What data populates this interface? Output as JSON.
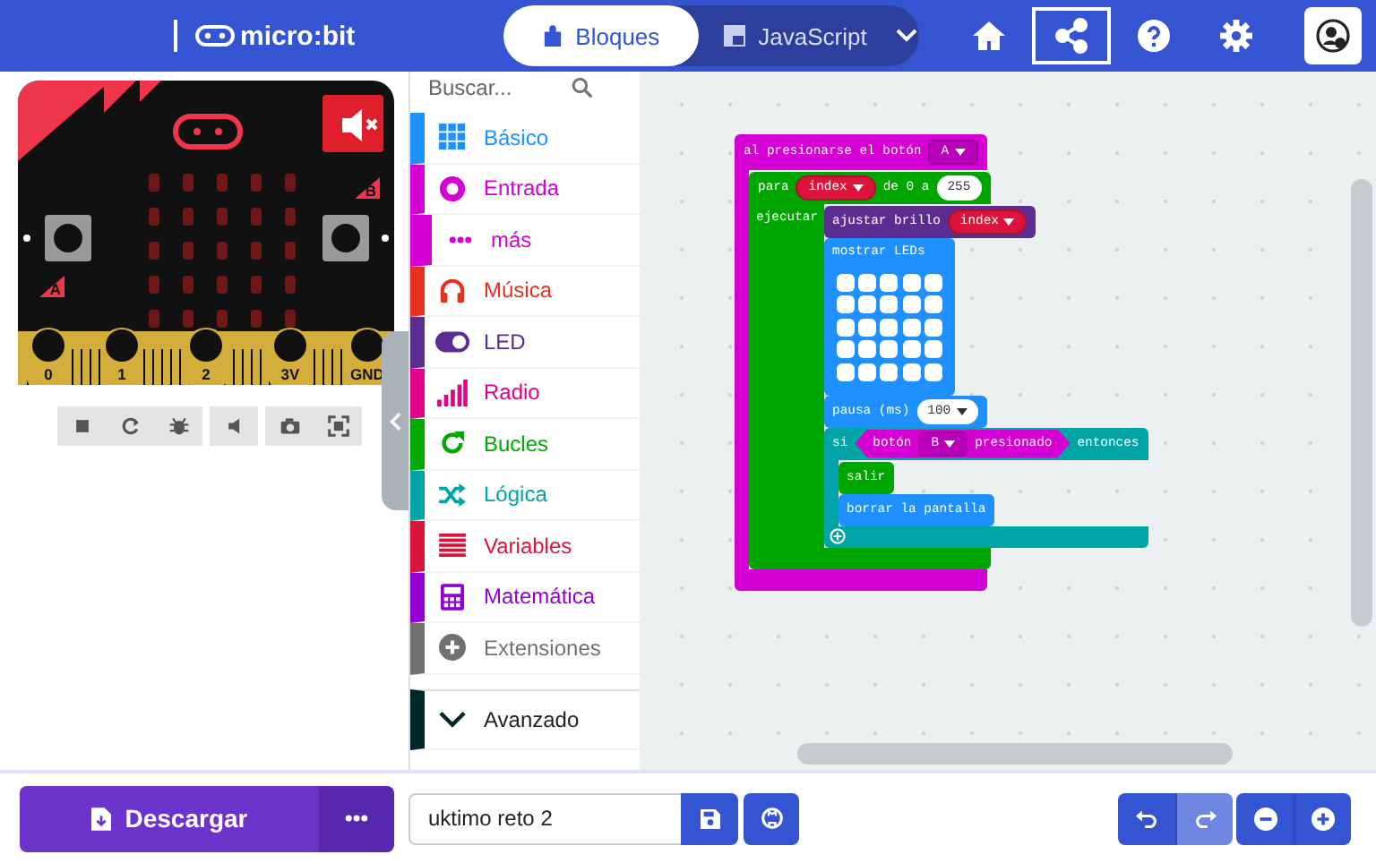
{
  "header": {
    "logo": "micro:bit",
    "tabs": [
      {
        "label": "Bloques",
        "selected": true
      },
      {
        "label": "JavaScript",
        "selected": false
      }
    ],
    "toolbar": [
      {
        "kind": "home",
        "selected": false
      },
      {
        "kind": "share",
        "selected": true
      },
      {
        "kind": "help",
        "selected": false
      },
      {
        "kind": "settings",
        "selected": false
      },
      {
        "kind": "account",
        "selected": false
      }
    ]
  },
  "simulator": {
    "muted": true,
    "buttons": [
      "A",
      "B"
    ],
    "pins": [
      "0",
      "1",
      "2",
      "3V",
      "GND"
    ],
    "controls": [
      {
        "kind": "stop"
      },
      {
        "kind": "restart"
      },
      {
        "kind": "debug"
      },
      {
        "kind": "mute"
      },
      {
        "kind": "screenshot"
      },
      {
        "kind": "fullscreen"
      }
    ]
  },
  "toolbox": {
    "placeholder": "Buscar...",
    "categories": [
      {
        "label": "Básico",
        "color": "#1e90ff",
        "kind": "category"
      },
      {
        "label": "Entrada",
        "color": "#d400d4",
        "kind": "category"
      },
      {
        "label": "más",
        "color": "#d400d4",
        "kind": "sub"
      },
      {
        "label": "Música",
        "color": "#e63022",
        "kind": "category"
      },
      {
        "label": "LED",
        "color": "#5c2d91",
        "kind": "category"
      },
      {
        "label": "Radio",
        "color": "#e3008c",
        "kind": "category"
      },
      {
        "label": "Bucles",
        "color": "#00aa00",
        "kind": "category"
      },
      {
        "label": "Lógica",
        "color": "#00a4a6",
        "kind": "category"
      },
      {
        "label": "Variables",
        "color": "#dc143c",
        "kind": "category"
      },
      {
        "label": "Matemática",
        "color": "#9400d3",
        "kind": "category"
      },
      {
        "label": "Extensiones",
        "color": "#717171",
        "kind": "category"
      },
      {
        "label": "Avanzado",
        "color": "#00272b",
        "kind": "advanced"
      }
    ]
  },
  "workspace": {
    "script": {
      "kind": "event",
      "color": "#d400d4",
      "parts": [
        {
          "kind": "text",
          "text": "al presionarse el botón"
        },
        {
          "kind": "dropdown",
          "text": "A"
        }
      ],
      "body": [
        {
          "kind": "loop",
          "color": "#00a500",
          "body_label": "ejecutar",
          "parts": [
            {
              "kind": "text",
              "text": "para"
            },
            {
              "kind": "variable",
              "text": "index"
            },
            {
              "kind": "text",
              "text": "de 0 a"
            },
            {
              "kind": "number",
              "text": "255"
            }
          ],
          "body": [
            {
              "kind": "statement",
              "color": "#5c2d91",
              "parts": [
                {
                  "kind": "text",
                  "text": "ajustar brillo"
                },
                {
                  "kind": "variable",
                  "text": "index"
                }
              ]
            },
            {
              "kind": "leds",
              "color": "#1e90ff",
              "parts": [
                {
                  "kind": "text",
                  "text": "mostrar LEDs"
                }
              ]
            },
            {
              "kind": "statement",
              "color": "#1e90ff",
              "parts": [
                {
                  "kind": "text",
                  "text": "pausa (ms)"
                },
                {
                  "kind": "number_dropdown",
                  "text": "100"
                }
              ]
            },
            {
              "kind": "if",
              "color": "#00a4a6",
              "parts": [
                {
                  "kind": "text",
                  "text": "si"
                },
                {
                  "kind": "boolean",
                  "color": "#d400d4",
                  "parts": [
                    {
                      "kind": "text",
                      "text": "botón"
                    },
                    {
                      "kind": "dropdown",
                      "text": "B"
                    },
                    {
                      "kind": "text",
                      "text": "presionado"
                    }
                  ]
                },
                {
                  "kind": "text",
                  "text": "entonces"
                }
              ],
              "body": [
                {
                  "kind": "statement",
                  "color": "#00a500",
                  "parts": [
                    {
                      "kind": "text",
                      "text": "salir"
                    }
                  ]
                },
                {
                  "kind": "statement",
                  "color": "#1e90ff",
                  "parts": [
                    {
                      "kind": "text",
                      "text": "borrar la pantalla"
                    }
                  ]
                }
              ]
            }
          ]
        }
      ]
    }
  },
  "footer": {
    "download": "Descargar",
    "project_name": "uktimo reto 2",
    "undo": {
      "disabled": false
    },
    "redo": {
      "disabled": true
    }
  }
}
